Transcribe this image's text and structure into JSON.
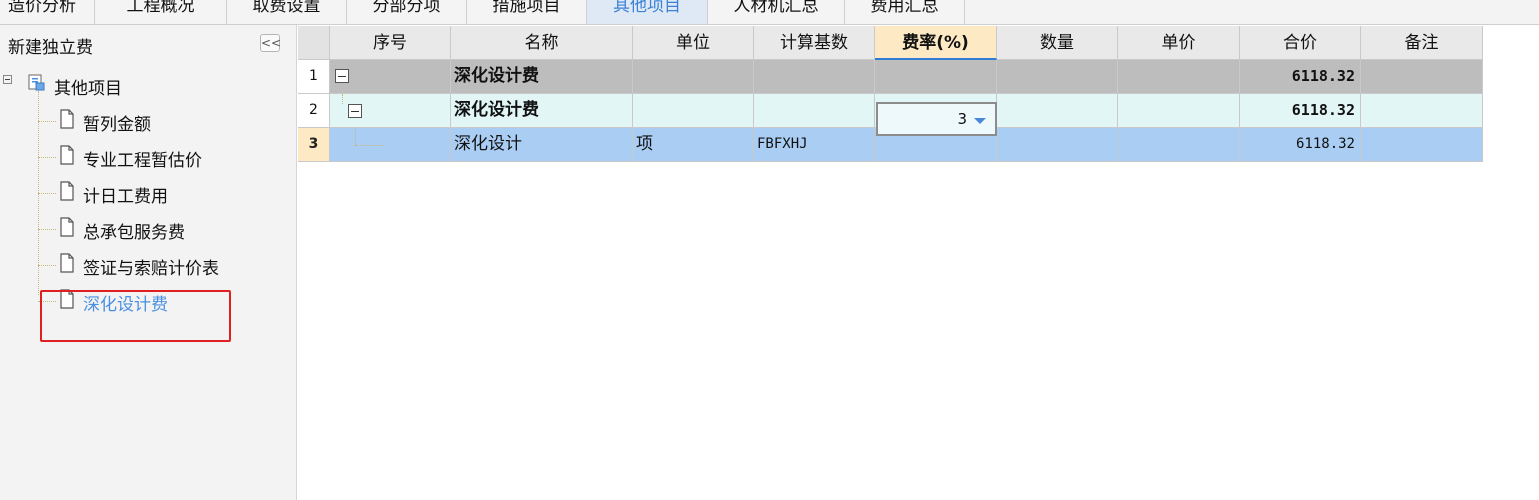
{
  "tabs": [
    {
      "label": "造价分析",
      "active": false
    },
    {
      "label": "工程概况",
      "active": false
    },
    {
      "label": "取费设置",
      "active": false
    },
    {
      "label": "分部分项",
      "active": false
    },
    {
      "label": "措施项目",
      "active": false
    },
    {
      "label": "其他项目",
      "active": true
    },
    {
      "label": "人材机汇总",
      "active": false
    },
    {
      "label": "费用汇总",
      "active": false
    }
  ],
  "sidebar": {
    "title": "新建独立费",
    "collapse_label": "<<",
    "root": {
      "label": "其他项目",
      "icon": "project-folder-icon"
    },
    "items": [
      {
        "label": "暂列金额",
        "icon": "document-icon"
      },
      {
        "label": "专业工程暂估价",
        "icon": "document-icon"
      },
      {
        "label": "计日工费用",
        "icon": "document-icon"
      },
      {
        "label": "总承包服务费",
        "icon": "document-icon"
      },
      {
        "label": "签证与索赔计价表",
        "icon": "document-icon"
      },
      {
        "label": "深化设计费",
        "icon": "document-icon",
        "selected": true
      }
    ]
  },
  "grid": {
    "columns": [
      "序号",
      "名称",
      "单位",
      "计算基数",
      "费率(%)",
      "数量",
      "单价",
      "合价",
      "备注"
    ],
    "rows": [
      {
        "num": "1",
        "name": "深化设计费",
        "unit": "",
        "base": "",
        "rate": "",
        "qty": "",
        "price": "",
        "total": "6118.32",
        "note": ""
      },
      {
        "num": "2",
        "name": "深化设计费",
        "unit": "",
        "base": "",
        "rate": "",
        "qty": "",
        "price": "",
        "total": "6118.32",
        "note": ""
      },
      {
        "num": "3",
        "name": "深化设计",
        "unit": "项",
        "base": "FBFXHJ",
        "rate": "3",
        "qty": "",
        "price": "",
        "total": "6118.32",
        "note": ""
      }
    ]
  },
  "colors": {
    "active_tab_text": "#3b82d6",
    "row1_bg": "#bdbdbd",
    "row2_bg": "#e2f6f6",
    "row3_bg": "#a9cdf3",
    "highlight_box": "#e02020"
  }
}
